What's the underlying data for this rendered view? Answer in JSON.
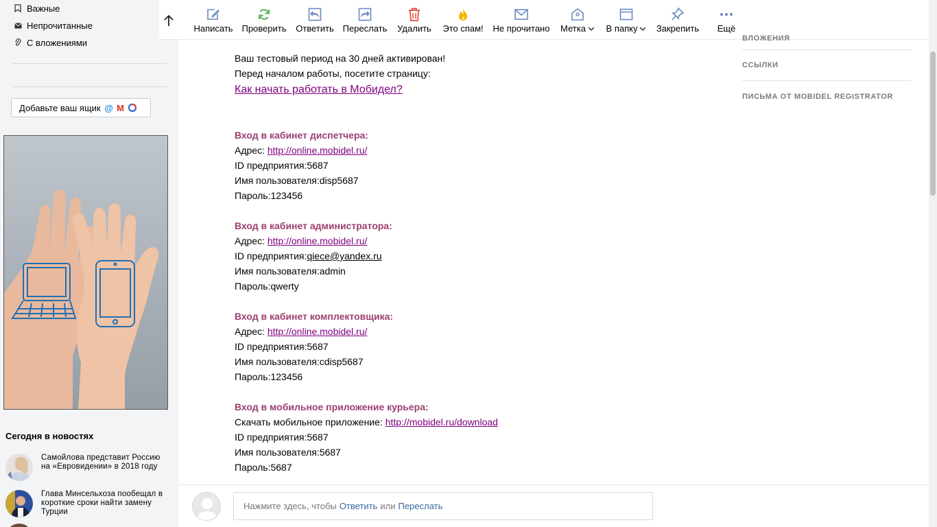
{
  "sidebar": {
    "folders": [
      {
        "icon": "bookmark-icon",
        "label": "Важные"
      },
      {
        "icon": "envelope-icon",
        "label": "Непрочитанные"
      },
      {
        "icon": "paperclip-icon",
        "label": "С вложениями"
      }
    ],
    "add_mailbox_label": "Добавьте ваш ящик",
    "news": {
      "title": "Сегодня в новостях",
      "items": [
        {
          "text": "Самойлова представит Россию на «Евровидении» в 2018 году"
        },
        {
          "text": "Глава Минсельхоза пообещал в короткие сроки найти замену Турции"
        }
      ]
    }
  },
  "toolbar": {
    "buttons": [
      {
        "label": "Написать",
        "icon": "compose-icon"
      },
      {
        "label": "Проверить",
        "icon": "refresh-icon"
      },
      {
        "label": "Ответить",
        "icon": "reply-icon"
      },
      {
        "label": "Переслать",
        "icon": "forward-icon"
      },
      {
        "label": "Удалить",
        "icon": "trash-icon"
      },
      {
        "label": "Это спам!",
        "icon": "spam-icon"
      },
      {
        "label": "Не прочитано",
        "icon": "unread-icon"
      },
      {
        "label": "Метка",
        "icon": "tag-icon"
      },
      {
        "label": "В папку",
        "icon": "folder-icon"
      },
      {
        "label": "Закрепить",
        "icon": "pin-icon"
      },
      {
        "label": "Ещё",
        "icon": "more-icon"
      }
    ]
  },
  "message": {
    "intro1": "Ваш тестовый период на 30 дней активирован!",
    "intro2": "Перед началом работы, посетите страницу:",
    "start_link": "Как начать работать в Мобидел?",
    "sections": [
      {
        "heading": "Вход в кабинет диспетчера:",
        "addr_prefix": "Адрес: ",
        "addr": "http://online.mobidel.ru/",
        "org": "ID предприятия:5687",
        "user": "Имя пользователя:disp5687",
        "pass": "Пароль:123456"
      },
      {
        "heading": "Вход в кабинет администратора:",
        "addr_prefix": "Адрес: ",
        "addr": "http://online.mobidel.ru/",
        "org_prefix": "ID предприятия:",
        "org_link": "qiece@yandex.ru",
        "user": "Имя пользователя:admin",
        "pass": "Пароль:qwerty"
      },
      {
        "heading": "Вход в кабинет комплектовщика:",
        "addr_prefix": "Адрес: ",
        "addr": "http://online.mobidel.ru/",
        "org": "ID предприятия:5687",
        "user": "Имя пользователя:cdisp5687",
        "pass": "Пароль:123456"
      },
      {
        "heading": "Вход в мобильное приложение курьера:",
        "addr_prefix": "Скачать мобильное приложение: ",
        "addr": "http://mobidel.ru/download",
        "org": "ID предприятия:5687",
        "user": "Имя пользователя:5687",
        "pass": "Пароль:5687"
      }
    ]
  },
  "right_panel": {
    "items": [
      "ВЛОЖЕНИЯ",
      "ССЫЛКИ",
      "ПИСЬМА ОТ MOBIDEL REGISTRATOR"
    ]
  },
  "reply": {
    "prefix": "Нажмите здесь, чтобы",
    "reply_link": "Ответить",
    "or": "или",
    "forward_link": "Переслать"
  },
  "colors": {
    "heading": "#9c3f6f",
    "link": "#800080",
    "reply_link": "#3a67a0"
  }
}
